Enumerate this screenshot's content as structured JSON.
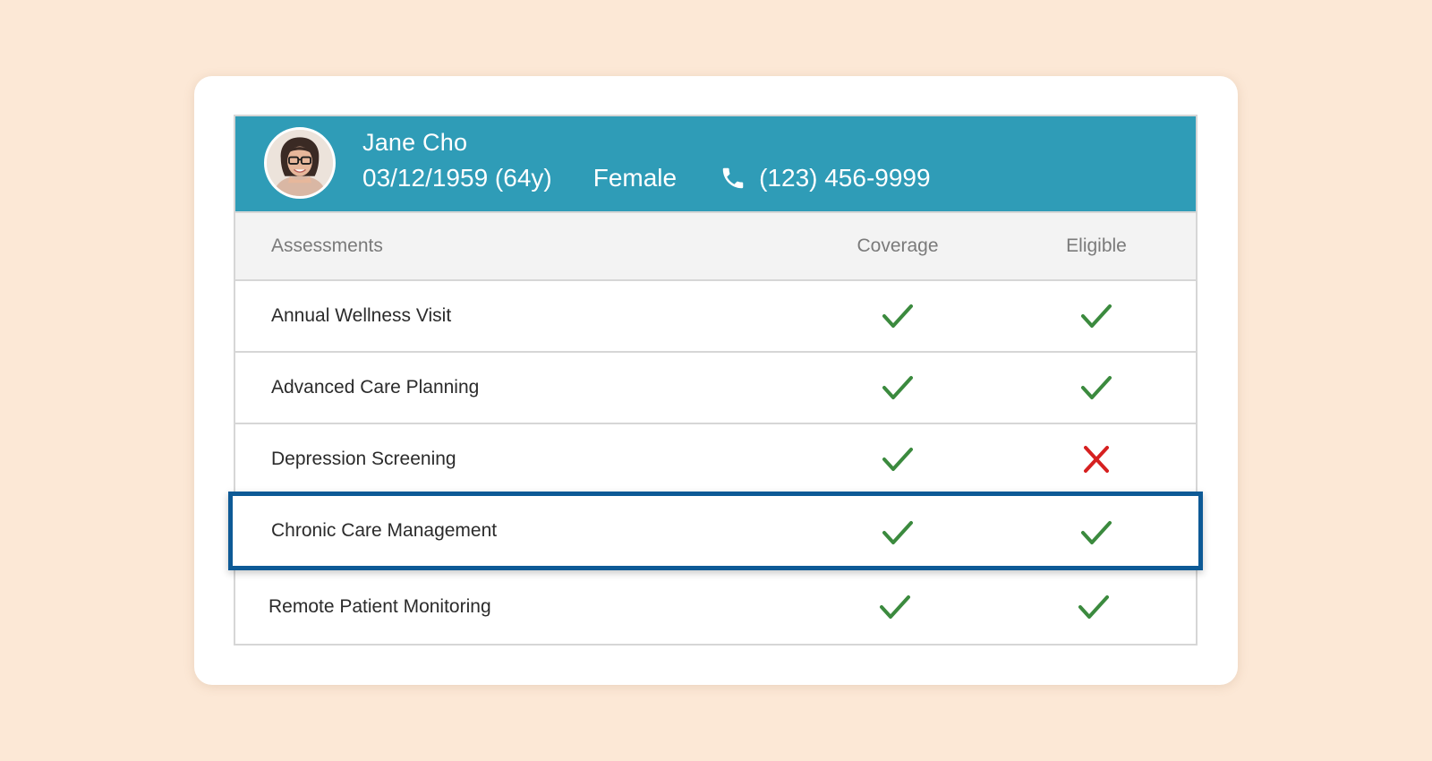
{
  "patient": {
    "name": "Jane Cho",
    "dob": "03/12/1959 (64y)",
    "gender": "Female",
    "phone": "(123) 456-9999"
  },
  "table": {
    "headers": {
      "assessments": "Assessments",
      "coverage": "Coverage",
      "eligible": "Eligible"
    },
    "rows": [
      {
        "label": "Annual Wellness Visit",
        "coverage": "check-icon",
        "eligible": "check-icon"
      },
      {
        "label": "Advanced Care Planning",
        "coverage": "check-icon",
        "eligible": "check-icon"
      },
      {
        "label": "Depression Screening",
        "coverage": "check-icon",
        "eligible": "cross-icon"
      },
      {
        "label": "Chronic Care Management",
        "coverage": "check-icon",
        "eligible": "check-icon",
        "highlighted": true
      },
      {
        "label": "Remote Patient Monitoring",
        "coverage": "check-icon",
        "eligible": "check-icon"
      }
    ]
  },
  "colors": {
    "background": "#fce8d6",
    "header": "#2f9cb7",
    "check": "#3b8a3e",
    "cross": "#d62020",
    "highlight_border": "#0d5a96"
  }
}
